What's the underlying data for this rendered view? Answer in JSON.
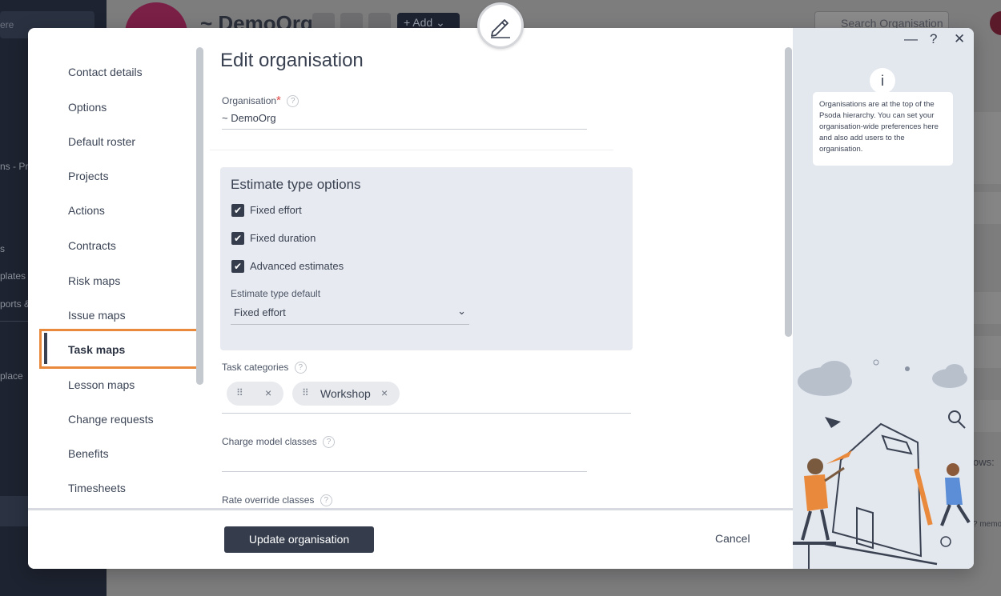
{
  "background": {
    "search_left_placeholder": "ere",
    "side_texts": [
      "ns - Pro",
      "s",
      "plates",
      "ports &",
      "place"
    ],
    "org_title": "~ DemoOrg",
    "add_label": "Add",
    "search_placeholder": "Search Organisation",
    "right_text_1": "ows:",
    "right_text_2": "? memo"
  },
  "modal": {
    "nav": {
      "items": [
        {
          "label": "Contact details"
        },
        {
          "label": "Options"
        },
        {
          "label": "Default roster"
        },
        {
          "label": "Projects"
        },
        {
          "label": "Actions"
        },
        {
          "label": "Contracts"
        },
        {
          "label": "Risk maps"
        },
        {
          "label": "Issue maps"
        },
        {
          "label": "Task maps"
        },
        {
          "label": "Lesson maps"
        },
        {
          "label": "Change requests"
        },
        {
          "label": "Benefits"
        },
        {
          "label": "Timesheets"
        }
      ],
      "active_item": "Task maps"
    },
    "form": {
      "title": "Edit organisation",
      "organisation_label": "Organisation",
      "organisation_required_mark": "*",
      "organisation_value": "~ DemoOrg",
      "estimate": {
        "title": "Estimate type options",
        "options": [
          {
            "label": "Fixed effort",
            "checked": true
          },
          {
            "label": "Fixed duration",
            "checked": true
          },
          {
            "label": "Advanced estimates",
            "checked": true
          }
        ],
        "default_label": "Estimate type default",
        "default_value": "Fixed effort"
      },
      "task_categories_label": "Task categories",
      "task_categories": [
        {
          "label": ""
        },
        {
          "label": "Workshop"
        }
      ],
      "charge_model_label": "Charge model classes",
      "rate_override_label": "Rate override classes"
    },
    "footer": {
      "update_label": "Update organisation",
      "cancel_label": "Cancel"
    },
    "help": {
      "info_glyph": "i",
      "text": "Organisations are at the top of the Psoda hierarchy. You can set your organisation-wide preferences here and also add users to the organisation.",
      "minimize": "—",
      "help": "?",
      "close": "✕"
    }
  },
  "colors": {
    "accent_orange": "#e9893b",
    "primary_dark": "#353d4d",
    "panel_bg": "#e7eaf0"
  }
}
